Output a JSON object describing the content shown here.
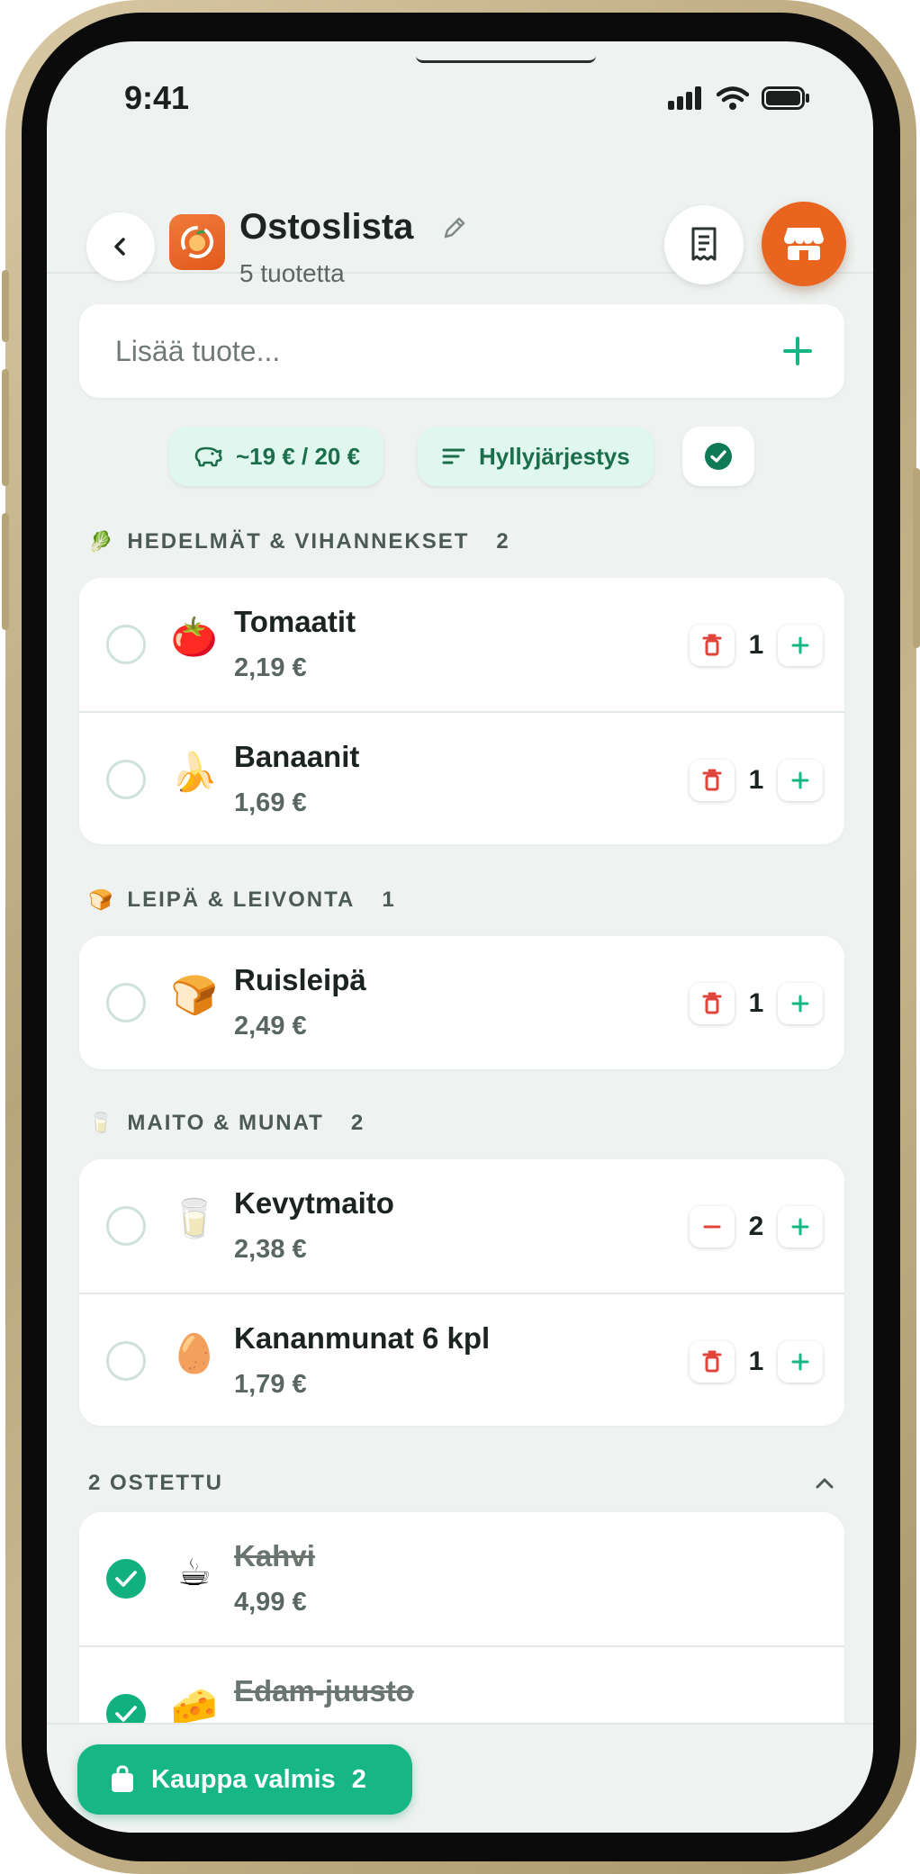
{
  "status": {
    "time": "9:41"
  },
  "header": {
    "title": "Ostoslista",
    "subtitle": "5 tuotetta"
  },
  "add": {
    "placeholder": "Lisää tuote..."
  },
  "chips": {
    "budget": "~19 € / 20 €",
    "sort": "Hyllyjärjestys"
  },
  "categories": [
    {
      "emoji": "🥬",
      "name": "HEDELMÄT & VIHANNEKSET",
      "count": "2",
      "items": [
        {
          "emoji": "🍅",
          "name": "Tomaatit",
          "price": "2,19 €",
          "qty": "1",
          "minus": "trash-icon"
        },
        {
          "emoji": "🍌",
          "name": "Banaanit",
          "price": "1,69 €",
          "qty": "1",
          "minus": "trash-icon"
        }
      ]
    },
    {
      "emoji": "🍞",
      "name": "LEIPÄ & LEIVONTA",
      "count": "1",
      "items": [
        {
          "emoji": "🍞",
          "name": "Ruisleipä",
          "price": "2,49 €",
          "qty": "1",
          "minus": "trash-icon"
        }
      ]
    },
    {
      "emoji": "🥛",
      "name": "MAITO & MUNAT",
      "count": "2",
      "items": [
        {
          "emoji": "🥛",
          "name": "Kevytmaito",
          "price": "2,38 €",
          "qty": "2",
          "minus": "minus-icon"
        },
        {
          "emoji": "🥚",
          "name": "Kananmunat 6 kpl",
          "price": "1,79 €",
          "qty": "1",
          "minus": "trash-icon"
        }
      ]
    }
  ],
  "bought": {
    "heading": "2 OSTETTU",
    "items": [
      {
        "emoji": "☕",
        "name": "Kahvi",
        "price": "4,99 €"
      },
      {
        "emoji": "🧀",
        "name": "Edam-juusto"
      }
    ]
  },
  "footer": {
    "done_label": "Kauppa valmis",
    "done_count": "2"
  },
  "colors": {
    "accent": "#16b784",
    "brand": "#e8641f",
    "danger": "#e0443a"
  }
}
